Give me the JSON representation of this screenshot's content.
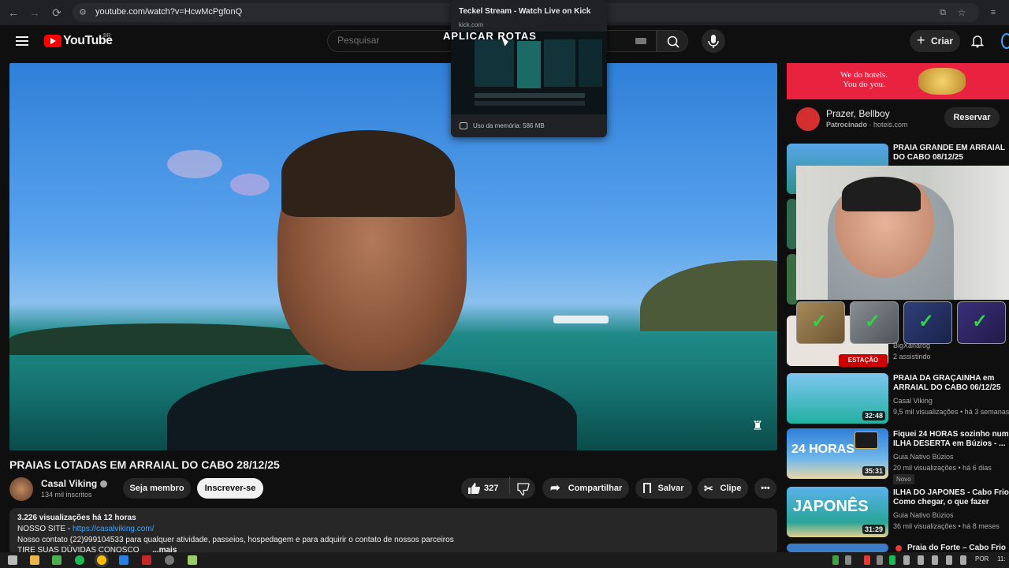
{
  "browser": {
    "url": "youtube.com/watch?v=HcwMcPgfonQ",
    "tab_tooltip": {
      "title": "Teckel Stream - Watch Live on Kick",
      "domain": "kick.com",
      "memory": "Uso da memória: 586 MB"
    }
  },
  "overlay_text": "APLICAR ROTAS",
  "header": {
    "logo": "YouTube",
    "country": "BR",
    "search_placeholder": "Pesquisar",
    "create_label": "Criar"
  },
  "video": {
    "title": "PRAIAS LOTADAS EM ARRAIAL DO CABO 28/12/25",
    "channel": "Casal Viking",
    "subscribers": "134 mil inscritos",
    "join_label": "Seja membro",
    "subscribe_label": "Inscrever-se",
    "likes": "327",
    "share_label": "Compartilhar",
    "save_label": "Salvar",
    "clip_label": "Clipe"
  },
  "description": {
    "meta": "3.226 visualizações  há 12 horas",
    "site_label": "NOSSO SITE - ",
    "site_link": "https://casalviking.com/",
    "contact": "Nosso contato (22)999104533 para qualquer atividade, passeios, hospedagem e para adquirir o contato de nossos parceiros",
    "line3": "TIRE SUAS DÚVIDAS CONOSCO",
    "more": "...mais"
  },
  "ad": {
    "banner_line1": "We do hotels.",
    "banner_line2": "You do you.",
    "title": "Prazer, Bellboy",
    "sponsored": "Patrocinado",
    "domain": "hoteis.com",
    "button": "Reservar"
  },
  "related": [
    {
      "title": "PRAIA GRANDE EM ARRAIAL DO CABO 08/12/25",
      "channel": "",
      "meta": "",
      "duration": ""
    },
    {
      "title": "",
      "channel": "BigXanarog",
      "meta": "2 assistindo",
      "duration": ""
    },
    {
      "title": "PRAIA DA GRAÇAINHA em ARRAIAL DO CABO 06/12/25",
      "channel": "Casal Viking",
      "meta": "9,5 mil visualizações • há 3 semanas",
      "duration": "32:48"
    },
    {
      "title": "Fiquei 24 HORAS sozinho num ILHA DESERTA em Búzios - ...",
      "channel": "Guia Nativo Búzios",
      "meta": "20 mil visualizações • há 6 dias",
      "badge": "Novo",
      "duration": "35:31",
      "thumb_text": "24 HORAS"
    },
    {
      "title": "ILHA DO JAPONES - Cabo Frio Como chegar, o que fazer",
      "channel": "Guia Nativo Búzios",
      "meta": "36 mil visualizações • há 8 meses",
      "duration": "31:29",
      "thumb_text": "JAPONÊS"
    },
    {
      "title": "Praia do Forte – Cabo Frio",
      "channel": "",
      "meta": "",
      "duration": ""
    }
  ],
  "live_badge": "ESTAÇÃO",
  "taskbar": {
    "lang": "POR",
    "time": "11:"
  }
}
